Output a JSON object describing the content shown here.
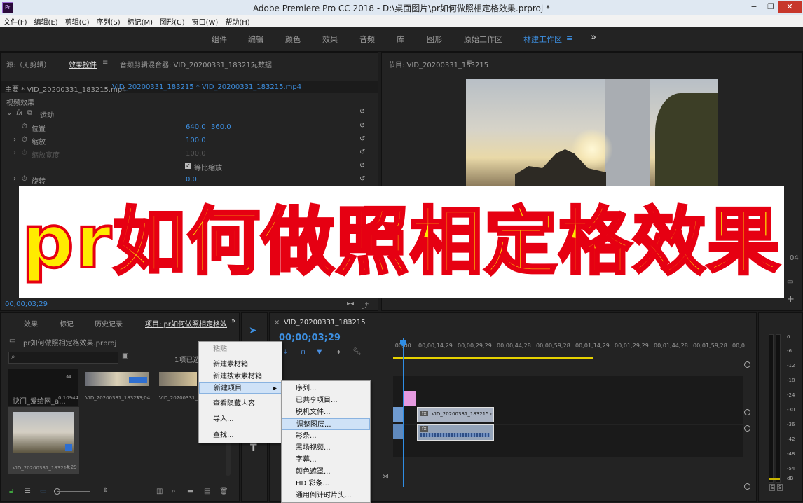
{
  "window": {
    "title": "Adobe Premiere Pro CC 2018 - D:\\桌面图片\\pr如何做照相定格效果.prproj *",
    "icon": "Pr",
    "minimize": "−",
    "maximize": "❐",
    "close": "✕"
  },
  "menubar": [
    "文件(F)",
    "编辑(E)",
    "剪辑(C)",
    "序列(S)",
    "标记(M)",
    "图形(G)",
    "窗口(W)",
    "帮助(H)"
  ],
  "workspaces": {
    "tabs": [
      "组件",
      "编辑",
      "颜色",
      "效果",
      "音频",
      "库",
      "图形",
      "原始工作区",
      "林建工作区"
    ],
    "active": "林建工作区",
    "menu_icon": "≡",
    "more": "»"
  },
  "source_panel": {
    "tabs": [
      "源:（无剪辑）",
      "效果控件",
      "音频剪辑混合器: VID_20200331_183215",
      "元数据"
    ],
    "tab_menu": "≡",
    "master_label": "主要 * VID_20200331_183215.mp4",
    "sequence_label": "VID_20200331_183215 * VID_20200331_183215.mp4",
    "section": "视频效果",
    "fx": "fx",
    "motion": "运动",
    "properties": [
      {
        "name": "位置",
        "v1": "640.0",
        "v2": "360.0"
      },
      {
        "name": "缩放",
        "v1": "100.0",
        "v2": ""
      },
      {
        "name": "缩放宽度",
        "v1": "100.0",
        "v2": ""
      },
      {
        "name": "等比缩放",
        "v1": "",
        "v2": ""
      },
      {
        "name": "旋转",
        "v1": "0.0",
        "v2": ""
      }
    ],
    "timecode": "00;00;03;29"
  },
  "program_panel": {
    "title": "节目: VID_20200331_183215",
    "menu": "≡",
    "timecode_partial": "04"
  },
  "banner": {
    "text": "pr如何做照相定格效果"
  },
  "project_panel": {
    "tabs": [
      "效果",
      "标记",
      "历史记录",
      "项目: pr如何做照相定格效"
    ],
    "project_file": "pr如何做照相定格效果.prproj",
    "search_placeholder": "",
    "selected_count": "1项已选",
    "items": [
      {
        "name": "快门_爱给网_a...",
        "duration": "0:10944"
      },
      {
        "name": "VID_20200331_18321...",
        "duration": "33;04"
      },
      {
        "name": "VID_20200331_18321...",
        "duration": ""
      },
      {
        "name": "VID_20200331_183215...",
        "duration": "4;29"
      }
    ]
  },
  "context_menu": {
    "items": [
      "粘贴",
      "新建素材箱",
      "新建搜索素材箱",
      "新建项目",
      "查看隐藏内容",
      "导入...",
      "查找..."
    ],
    "highlighted": "新建项目",
    "disabled": "粘贴",
    "arrow": "▸"
  },
  "submenu": {
    "items": [
      "序列...",
      "已共享项目...",
      "脱机文件...",
      "调整图层...",
      "彩条...",
      "黑场视频...",
      "字幕...",
      "颜色遮罩...",
      "HD 彩条...",
      "通用倒计时片头..."
    ],
    "highlighted": "调整图层..."
  },
  "timeline": {
    "tab": "VID_20200331_183215",
    "close": "×",
    "menu": "≡",
    "timecode": "00;00;03;29",
    "ruler": [
      ":00;00",
      "00;00;14;29",
      "00;00;29;29",
      "00;00;44;28",
      "00;00;59;28",
      "00;01;14;29",
      "00;01;29;29",
      "00;01;44;28",
      "00;01;59;28",
      "00;0"
    ],
    "clip_video": "VID_20200331_183215.mp4 [V]",
    "clip_fx": "fx"
  },
  "meter": {
    "labels": [
      "0",
      "-6",
      "-12",
      "-18",
      "-24",
      "-30",
      "-36",
      "-42",
      "-48",
      "-54",
      "dB"
    ],
    "solo": [
      "S",
      "S"
    ]
  },
  "colors": {
    "accent_blue": "#3d8fe0",
    "playhead": "#2f8de4",
    "banner_fill": "#ffeb00",
    "banner_stroke": "#e60012"
  }
}
